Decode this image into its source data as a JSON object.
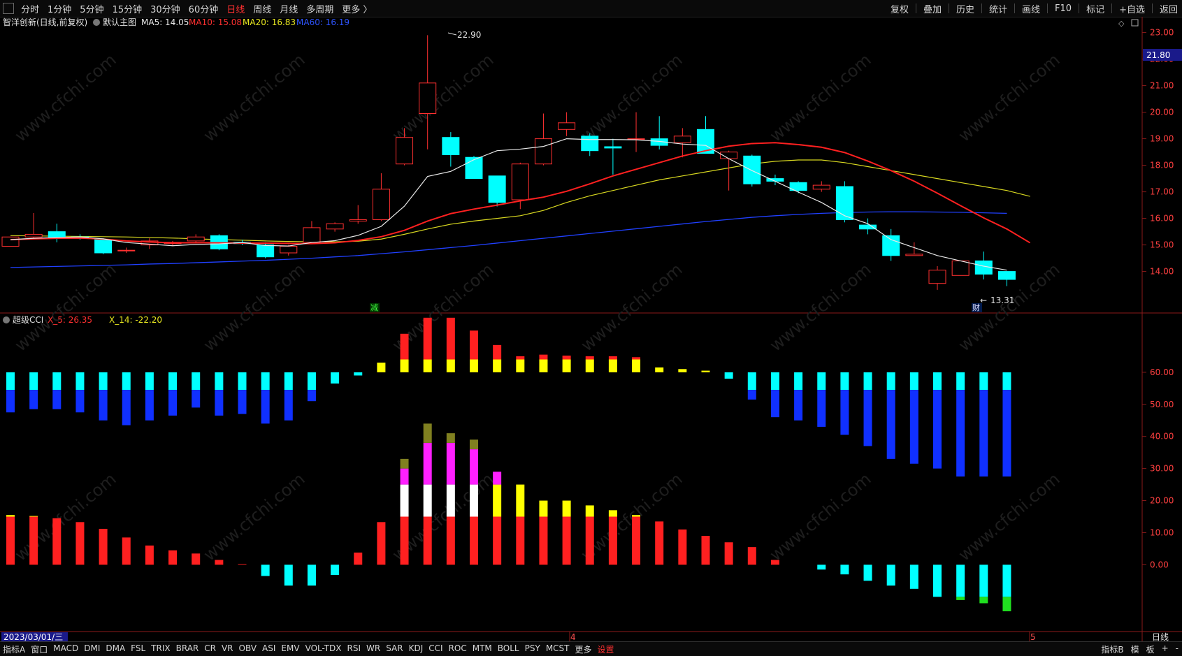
{
  "top_toolbar": {
    "periods": [
      "分时",
      "1分钟",
      "5分钟",
      "15分钟",
      "30分钟",
      "60分钟",
      "日线",
      "周线",
      "月线",
      "多周期",
      "更多 〉"
    ],
    "active_period": "日线",
    "right_tools": [
      "复权",
      "叠加",
      "历史",
      "统计",
      "画线",
      "F10",
      "标记",
      "+自选",
      "返回"
    ]
  },
  "main_panel": {
    "title": "智洋创新(日线,前复权)",
    "template": "默认主图",
    "ma5": "MA5: 14.05",
    "ma10": "MA10: 15.08",
    "ma20": "MA20: 16.83",
    "ma60": "MA60: 16.19",
    "high_label": "22.90",
    "low_label": "13.31",
    "current_price": "21.80",
    "marker_reduce": "减",
    "marker_finance": "财",
    "y_ticks": [
      "23.00",
      "22.00",
      "21.00",
      "20.00",
      "19.00",
      "18.00",
      "17.00",
      "16.00",
      "15.00",
      "14.00"
    ]
  },
  "cci_panel": {
    "title": "超级CCI",
    "x5": "X_5: 26.35",
    "x14": "X_14: -22.20",
    "y_ticks": [
      "60.00",
      "50.00",
      "40.00",
      "30.00",
      "20.00",
      "10.00",
      "0.00"
    ]
  },
  "time_axis": {
    "date": "2023/03/01/三",
    "month_4": "4",
    "month_5": "5",
    "period_label": "日线"
  },
  "bottom_tabs": {
    "items": [
      "指标A",
      "窗口",
      "MACD",
      "DMI",
      "DMA",
      "FSL",
      "TRIX",
      "BRAR",
      "CR",
      "VR",
      "OBV",
      "ASI",
      "EMV",
      "VOL-TDX",
      "RSI",
      "WR",
      "SAR",
      "KDJ",
      "CCI",
      "ROC",
      "MTM",
      "BOLL",
      "PSY",
      "MCST",
      "更多",
      "设置"
    ],
    "right": [
      "指标B",
      "模",
      "板",
      "+",
      "-"
    ]
  },
  "watermark": "www.cfchi.com",
  "colors": {
    "up": "#ff3030",
    "down": "#00ffff",
    "ma5": "#e8e8e8",
    "ma10": "#ff2020",
    "ma20": "#d8d820",
    "ma60": "#2040ff"
  },
  "chart_data": [
    {
      "type": "candlestick",
      "candles": [
        {
          "o": 14.95,
          "h": 15.3,
          "l": 14.95,
          "c": 15.3
        },
        {
          "o": 15.3,
          "h": 16.2,
          "l": 15.25,
          "c": 15.4
        },
        {
          "o": 15.5,
          "h": 15.8,
          "l": 15.1,
          "c": 15.3
        },
        {
          "o": 15.3,
          "h": 15.4,
          "l": 15.2,
          "c": 15.25
        },
        {
          "o": 15.2,
          "h": 15.25,
          "l": 14.65,
          "c": 14.7
        },
        {
          "o": 14.8,
          "h": 14.9,
          "l": 14.7,
          "c": 14.8
        },
        {
          "o": 15.0,
          "h": 15.25,
          "l": 14.85,
          "c": 15.15
        },
        {
          "o": 15.05,
          "h": 15.15,
          "l": 14.95,
          "c": 15.1
        },
        {
          "o": 15.15,
          "h": 15.4,
          "l": 15.1,
          "c": 15.3
        },
        {
          "o": 15.35,
          "h": 15.4,
          "l": 14.8,
          "c": 14.85
        },
        {
          "o": 15.1,
          "h": 15.2,
          "l": 15.0,
          "c": 15.05
        },
        {
          "o": 15.0,
          "h": 15.1,
          "l": 14.5,
          "c": 14.55
        },
        {
          "o": 14.7,
          "h": 15.0,
          "l": 14.6,
          "c": 14.95
        },
        {
          "o": 15.1,
          "h": 15.9,
          "l": 15.1,
          "c": 15.65
        },
        {
          "o": 15.6,
          "h": 15.85,
          "l": 15.5,
          "c": 15.8
        },
        {
          "o": 15.9,
          "h": 16.5,
          "l": 15.8,
          "c": 15.95
        },
        {
          "o": 15.95,
          "h": 17.7,
          "l": 15.9,
          "c": 17.1
        },
        {
          "o": 18.05,
          "h": 19.4,
          "l": 18.0,
          "c": 19.05
        },
        {
          "o": 19.95,
          "h": 22.9,
          "l": 18.6,
          "c": 21.1
        },
        {
          "o": 19.05,
          "h": 19.25,
          "l": 17.95,
          "c": 18.4
        },
        {
          "o": 18.3,
          "h": 18.35,
          "l": 17.5,
          "c": 17.5
        },
        {
          "o": 17.6,
          "h": 17.6,
          "l": 16.45,
          "c": 16.6
        },
        {
          "o": 16.7,
          "h": 18.1,
          "l": 16.35,
          "c": 18.05
        },
        {
          "o": 18.05,
          "h": 19.95,
          "l": 18.0,
          "c": 19.0
        },
        {
          "o": 19.35,
          "h": 20.0,
          "l": 19.1,
          "c": 19.6
        },
        {
          "o": 19.1,
          "h": 19.2,
          "l": 18.35,
          "c": 18.55
        },
        {
          "o": 18.7,
          "h": 19.0,
          "l": 17.65,
          "c": 18.65
        },
        {
          "o": 19.0,
          "h": 20.0,
          "l": 18.5,
          "c": 19.0
        },
        {
          "o": 19.0,
          "h": 19.85,
          "l": 18.6,
          "c": 18.75
        },
        {
          "o": 18.85,
          "h": 19.4,
          "l": 18.3,
          "c": 19.1
        },
        {
          "o": 19.35,
          "h": 19.85,
          "l": 18.45,
          "c": 18.45
        },
        {
          "o": 18.25,
          "h": 18.55,
          "l": 17.05,
          "c": 18.5
        },
        {
          "o": 18.35,
          "h": 18.4,
          "l": 17.2,
          "c": 17.3
        },
        {
          "o": 17.5,
          "h": 17.65,
          "l": 17.25,
          "c": 17.4
        },
        {
          "o": 17.35,
          "h": 17.4,
          "l": 16.95,
          "c": 17.05
        },
        {
          "o": 17.1,
          "h": 17.4,
          "l": 17.0,
          "c": 17.25
        },
        {
          "o": 17.2,
          "h": 17.4,
          "l": 15.85,
          "c": 15.95
        },
        {
          "o": 15.75,
          "h": 16.0,
          "l": 15.4,
          "c": 15.6
        },
        {
          "o": 15.35,
          "h": 15.6,
          "l": 14.4,
          "c": 14.6
        },
        {
          "o": 14.6,
          "h": 15.1,
          "l": 14.6,
          "c": 14.65
        },
        {
          "o": 13.55,
          "h": 14.2,
          "l": 13.31,
          "c": 14.05
        },
        {
          "o": 13.85,
          "h": 14.4,
          "l": 13.85,
          "c": 14.4
        },
        {
          "o": 14.4,
          "h": 14.75,
          "l": 13.7,
          "c": 13.9
        },
        {
          "o": 14.0,
          "h": 14.0,
          "l": 13.45,
          "c": 13.7
        }
      ],
      "ma5": [
        15.2,
        15.25,
        15.28,
        15.3,
        15.23,
        15.09,
        15.03,
        14.97,
        15.02,
        15.04,
        15.09,
        14.98,
        14.96,
        15.09,
        15.16,
        15.36,
        15.7,
        16.46,
        17.58,
        17.77,
        18.21,
        18.55,
        18.61,
        18.71,
        19.0,
        18.97,
        18.97,
        18.96,
        18.9,
        18.8,
        18.75,
        18.25,
        17.8,
        17.4,
        16.99,
        16.6,
        16.1,
        15.8,
        15.2,
        14.9,
        14.6,
        14.4,
        14.2,
        14.05
      ],
      "ma10": [
        15.2,
        15.23,
        15.25,
        15.26,
        15.22,
        15.15,
        15.11,
        15.08,
        15.08,
        15.08,
        15.07,
        15.07,
        15.06,
        15.05,
        15.08,
        15.17,
        15.31,
        15.55,
        15.9,
        16.18,
        16.35,
        16.5,
        16.66,
        16.8,
        17.02,
        17.3,
        17.6,
        17.85,
        18.1,
        18.35,
        18.55,
        18.72,
        18.82,
        18.85,
        18.78,
        18.68,
        18.48,
        18.16,
        17.8,
        17.4,
        16.95,
        16.48,
        16.02,
        15.6,
        15.08
      ],
      "ma20": [
        15.35,
        15.34,
        15.33,
        15.32,
        15.31,
        15.3,
        15.28,
        15.26,
        15.23,
        15.2,
        15.18,
        15.15,
        15.13,
        15.12,
        15.12,
        15.14,
        15.22,
        15.4,
        15.6,
        15.78,
        15.9,
        16.0,
        16.1,
        16.3,
        16.6,
        16.85,
        17.05,
        17.25,
        17.45,
        17.6,
        17.75,
        17.9,
        18.05,
        18.15,
        18.2,
        18.2,
        18.1,
        17.95,
        17.8,
        17.65,
        17.5,
        17.35,
        17.2,
        17.05,
        16.83
      ],
      "ma60": [
        14.15,
        14.17,
        14.19,
        14.21,
        14.23,
        14.25,
        14.28,
        14.3,
        14.33,
        14.36,
        14.39,
        14.42,
        14.46,
        14.5,
        14.55,
        14.6,
        14.67,
        14.74,
        14.82,
        14.9,
        14.98,
        15.07,
        15.16,
        15.25,
        15.34,
        15.43,
        15.52,
        15.61,
        15.7,
        15.79,
        15.88,
        15.96,
        16.04,
        16.1,
        16.15,
        16.19,
        16.22,
        16.24,
        16.25,
        16.25,
        16.24,
        16.23,
        16.21,
        16.19
      ],
      "y_range": [
        13.2,
        23.2
      ],
      "y_ticks": [
        23,
        22,
        21,
        20,
        19,
        18,
        17,
        16,
        15,
        14
      ]
    },
    {
      "type": "bar",
      "title": "超级CCI",
      "series": [
        {
          "name": "X_5",
          "values": [
            15.5,
            15.2,
            14.5,
            13.3,
            11.2,
            8.5,
            6.0,
            4.5,
            3.5,
            1.5,
            0.2,
            -3.5,
            -6.5,
            -6.5,
            -3.2,
            3.8,
            13.3,
            30.0,
            38.0,
            38.0,
            36.0,
            29.0,
            25.0,
            20.0,
            20.0,
            18.5,
            17.0,
            15.5,
            13.5,
            11.0,
            9.0,
            7.0,
            5.5,
            1.5,
            0.0,
            -1.5,
            -3.0,
            -5.0,
            -6.5,
            -7.5,
            -10.0,
            -11.0,
            -12.0,
            -14.5,
            -22.2
          ]
        },
        {
          "name": "X_14",
          "values": [
            -12.5,
            -11.5,
            -11.5,
            -12.5,
            -15.0,
            -16.5,
            -15.0,
            -13.5,
            -11.0,
            -13.5,
            -13.0,
            -16.0,
            -15.0,
            -9.0,
            -3.5,
            -1.0,
            3.0,
            12.0,
            17.0,
            17.0,
            13.0,
            8.5,
            5.0,
            5.5,
            5.2,
            5.0,
            5.0,
            4.7,
            1.5,
            1.0,
            0.5,
            -2.0,
            -8.5,
            -14.0,
            -15.0,
            -17.0,
            -19.5,
            -23.0,
            -27.0,
            -28.5,
            -30.0,
            -32.5,
            -32.5,
            -32.5,
            -26.35
          ]
        }
      ],
      "y_range": [
        -23.0,
        75.0
      ],
      "y_ticks": [
        60,
        50,
        40,
        30,
        20,
        10,
        0
      ]
    }
  ]
}
